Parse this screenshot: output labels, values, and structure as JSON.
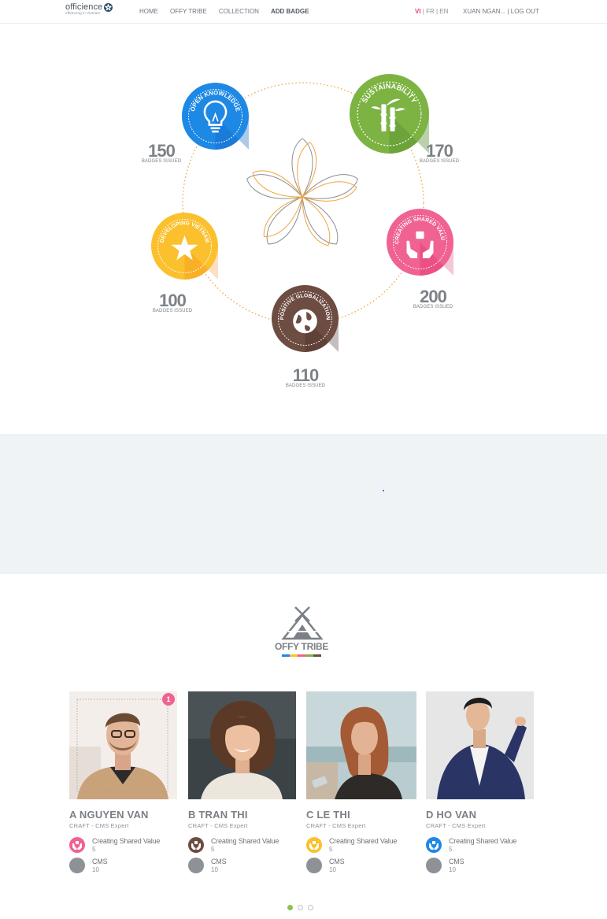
{
  "header": {
    "logo_text": "officience",
    "logo_tagline": "offshoring in Vietnam",
    "nav": [
      "HOME",
      "OFFY TRIBE",
      "COLLECTION",
      "ADD BADGE"
    ],
    "lang": {
      "vi": "VI",
      "sep1": " | ",
      "fr": "FR",
      "sep2": " | ",
      "en": "EN"
    },
    "user": "XUAN NGAN... | LOG OUT"
  },
  "badges": [
    {
      "title": "OPEN KNOWLEDGE",
      "count": "150",
      "label": "BADGES ISSUED",
      "color": "#1e88e5",
      "icon": "lightbulb-icon"
    },
    {
      "title": "SUSTAINABILITY",
      "count": "170",
      "label": "BADGES ISSUED",
      "color": "#7cb342",
      "icon": "bamboo-icon"
    },
    {
      "title": "CREATING SHARED VALUE",
      "count": "200",
      "label": "BADGES ISSUED",
      "color": "#f06292",
      "icon": "hands-icon"
    },
    {
      "title": "POSITIVE GLOBALIZATION",
      "count": "110",
      "label": "BADGES ISSUED",
      "color": "#6d4c41",
      "icon": "globe-icon"
    },
    {
      "title": "DEVELOPING VIETNAM",
      "count": "100",
      "label": "BADGES ISSUED",
      "color": "#fbc02d",
      "icon": "star-icon"
    }
  ],
  "tribe": {
    "title": "OFFY TRIBE",
    "bar_colors": [
      "#1e88e5",
      "#fbc02d",
      "#f06292",
      "#7cb342",
      "#6d4c41"
    ]
  },
  "members": [
    {
      "name": "A NGUYEN VAN",
      "role": "CRAFT - CMS Expert",
      "badge": "Creating Shared Value",
      "badge_count": "5",
      "badge_color": "#f06292",
      "skill": "CMS",
      "skill_count": "10",
      "notification": "1"
    },
    {
      "name": "B TRAN THI",
      "role": "CRAFT - CMS Expert",
      "badge": "Creating Shared Value",
      "badge_count": "5",
      "badge_color": "#6d4c41",
      "skill": "CMS",
      "skill_count": "10"
    },
    {
      "name": "C LE THI",
      "role": "CRAFT - CMS Expert",
      "badge": "Creating Shared Value",
      "badge_count": "5",
      "badge_color": "#fbc02d",
      "skill": "CMS",
      "skill_count": "10"
    },
    {
      "name": "D HO VAN",
      "role": "CRAFT - CMS Expert",
      "badge": "Creating Shared Value",
      "badge_count": "5",
      "badge_color": "#1e88e5",
      "skill": "CMS",
      "skill_count": "10"
    }
  ],
  "pager": {
    "pages": 3,
    "active": 0
  }
}
